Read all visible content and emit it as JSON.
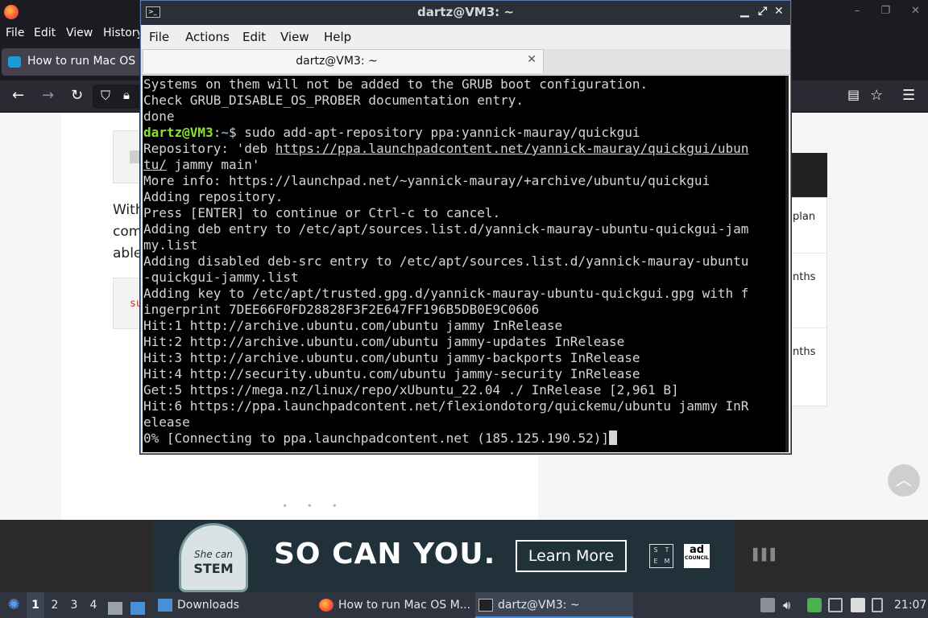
{
  "browser": {
    "menu": [
      "File",
      "Edit",
      "View",
      "History"
    ],
    "tab_title": "How to run Mac OS M",
    "window_controls": [
      "–",
      "❐",
      "✕"
    ]
  },
  "page": {
    "paragraph": [
      "With",
      "com",
      "able"
    ],
    "code_prefix_2": "su",
    "sidebar_snippets": [
      "plan",
      "nths",
      "nths"
    ]
  },
  "ad": {
    "badge_top": "She can",
    "badge_bottom": "STEM",
    "headline": "SO CAN YOU.",
    "cta": "Learn More",
    "stem_letters": [
      "S",
      "T",
      "E",
      "M"
    ],
    "council": "ad",
    "council_sub": "COUNCIL"
  },
  "terminal": {
    "title": "dartz@VM3: ~",
    "menu": [
      "File",
      "Actions",
      "Edit",
      "View",
      "Help"
    ],
    "tab_title": "dartz@VM3: ~",
    "prompt_user": "dartz@VM3",
    "prompt_sep": ":",
    "prompt_path": "~",
    "prompt_symbol": "$",
    "command": " sudo add-apt-repository ppa:yannick-mauray/quickgui",
    "lines_before": [
      "Systems on them will not be added to the GRUB boot configuration.",
      "Check GRUB_DISABLE_OS_PROBER documentation entry.",
      "done"
    ],
    "repo_prefix": "Repository: 'deb ",
    "repo_link_1": "https://ppa.launchpadcontent.net/yannick-mauray/quickgui/ubun",
    "repo_link_2": "tu/",
    "repo_suffix": " jammy main'",
    "lines_after": [
      "More info: https://launchpad.net/~yannick-mauray/+archive/ubuntu/quickgui",
      "Adding repository.",
      "Press [ENTER] to continue or Ctrl-c to cancel.",
      "Adding deb entry to /etc/apt/sources.list.d/yannick-mauray-ubuntu-quickgui-jam",
      "my.list",
      "Adding disabled deb-src entry to /etc/apt/sources.list.d/yannick-mauray-ubuntu",
      "-quickgui-jammy.list",
      "Adding key to /etc/apt/trusted.gpg.d/yannick-mauray-ubuntu-quickgui.gpg with f",
      "ingerprint 7DEE66F0FD28828F3F2E647FF196B5DB0E9C0606",
      "Hit:1 http://archive.ubuntu.com/ubuntu jammy InRelease",
      "Hit:2 http://archive.ubuntu.com/ubuntu jammy-updates InRelease",
      "Hit:3 http://archive.ubuntu.com/ubuntu jammy-backports InRelease",
      "Hit:4 http://security.ubuntu.com/ubuntu jammy-security InRelease",
      "Get:5 https://mega.nz/linux/repo/xUbuntu_22.04 ./ InRelease [2,961 B]",
      "Hit:6 https://ppa.launchpadcontent.net/flexiondotorg/quickemu/ubuntu jammy InR",
      "elease"
    ],
    "last_line": "0% [Connecting to ppa.launchpadcontent.net (185.125.190.52)]"
  },
  "taskbar": {
    "workspaces": [
      "1",
      "2",
      "3",
      "4"
    ],
    "active_workspace": "1",
    "tasks": [
      {
        "label": "Downloads",
        "icon": "folder-icon"
      },
      {
        "label": "How to run Mac OS M...",
        "icon": "firefox-icon"
      },
      {
        "label": "dartz@VM3: ~",
        "icon": "terminal-icon"
      }
    ],
    "clock": "21:07"
  }
}
